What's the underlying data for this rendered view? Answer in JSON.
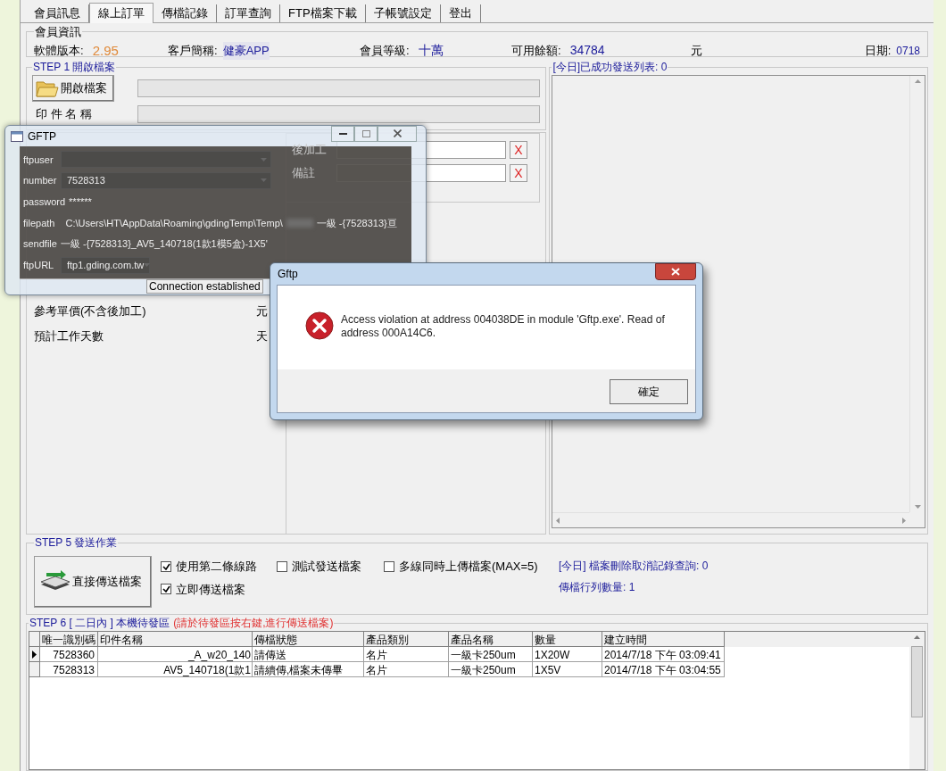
{
  "tabs": [
    {
      "label": "會員訊息",
      "selected": false
    },
    {
      "label": "線上訂單",
      "selected": true
    },
    {
      "label": "傳檔記錄",
      "selected": false
    },
    {
      "label": "訂單查詢",
      "selected": false
    },
    {
      "label": "FTP檔案下載",
      "selected": false
    },
    {
      "label": "子帳號設定",
      "selected": false
    },
    {
      "label": "登出",
      "selected": false
    }
  ],
  "member_info": {
    "title": "會員資訊",
    "fields": [
      {
        "label": "軟體版本:",
        "value": "2.95",
        "kind": "version"
      },
      {
        "label": "客戶簡稱:",
        "value": "健豪APP",
        "kind": "highlighted"
      },
      {
        "label": "會員等級:",
        "value": "十萬",
        "kind": "plain"
      },
      {
        "label": "可用餘額:",
        "value": "34784",
        "kind": "plain",
        "unit": "元"
      },
      {
        "label": "日期:",
        "value": "0718",
        "kind": "date"
      }
    ]
  },
  "step1": {
    "title": "STEP 1 開啟檔案",
    "open_button": "開啟檔案",
    "name_label": "印 件 名 稱"
  },
  "step4": {
    "fields": [
      {
        "label": "後加工",
        "clear_button": "X"
      },
      {
        "label": "備註",
        "clear_button": "X"
      }
    ]
  },
  "estimates": [
    {
      "label": "參考單價(不含後加工)",
      "unit": "元"
    },
    {
      "label": "預計工作天數",
      "unit": "天"
    }
  ],
  "sent_list": {
    "title": "[今日]已成功發送列表: 0"
  },
  "step5": {
    "title": "STEP 5 發送作業",
    "send_button": "直接傳送檔案",
    "options": [
      {
        "label": "使用第二條線路",
        "checked": true
      },
      {
        "label": "測試發送檔案",
        "checked": false
      },
      {
        "label": "多線同時上傳檔案(MAX=5)",
        "checked": false
      },
      {
        "label": "立即傳送檔案",
        "checked": true
      }
    ],
    "stats": [
      "[今日] 檔案刪除取消記錄查詢: 0",
      "傳檔行列數量: 1"
    ]
  },
  "step6": {
    "title": "STEP 6 [ 二日內 ] 本機待發區",
    "hint": "(請於待發區按右鍵,進行傳送檔案)",
    "columns": [
      "唯一識別碼",
      "印件名稱",
      "傳檔狀態",
      "產品類別",
      "產品名稱",
      "數量",
      "建立時間"
    ],
    "rows": [
      {
        "selected": true,
        "cells": [
          "7528360",
          "_A_w20_140",
          "請傳送",
          "名片",
          "一級卡250um",
          "1X20W",
          "2014/7/18 下午 03:09:41"
        ]
      },
      {
        "selected": false,
        "cells": [
          "7528313",
          "AV5_140718(1款1",
          "請續傳,檔案未傳畢",
          "名片",
          "一級卡250um",
          "1X5V",
          "2014/7/18 下午 03:04:55"
        ]
      }
    ]
  },
  "gftp_window": {
    "title": "GFTP",
    "fields": [
      {
        "label": "ftpuser",
        "kind": "dropdown"
      },
      {
        "label": "number",
        "value": "7528313",
        "kind": "dropdown"
      },
      {
        "label": "password",
        "value": "******",
        "kind": "text"
      },
      {
        "label": "filepath",
        "value": "C:\\Users\\HT\\AppData\\Roaming\\gdingTemp\\Temp\\",
        "tail": "一級 -{7528313}亘",
        "kind": "path"
      },
      {
        "label": "sendfile",
        "value": "一級 -{7528313}_AV5_140718(1款1模5盒)-1X5'",
        "kind": "text"
      },
      {
        "label": "ftpURL",
        "value": "ftp1.gding.com.tw",
        "kind": "small_dropdown"
      }
    ],
    "status": "Connection established"
  },
  "error_dialog": {
    "title": "Gftp",
    "message": "Access violation at address 004038DE in module 'Gftp.exe'. Read of address 000A14C6.",
    "button": "確定"
  }
}
